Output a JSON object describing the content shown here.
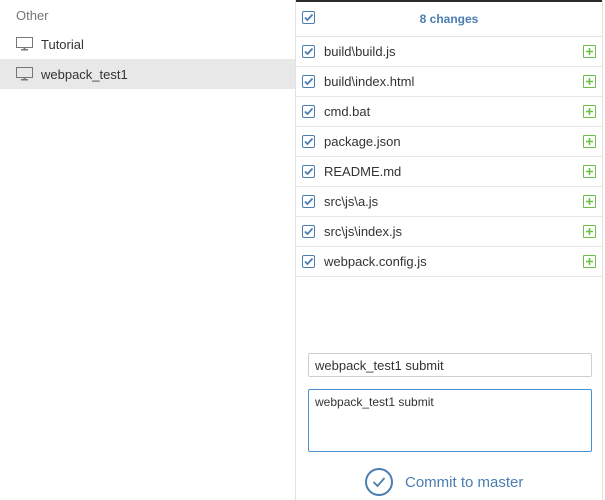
{
  "sidebar": {
    "section_title": "Other",
    "items": [
      {
        "label": "Tutorial",
        "icon": "monitor-icon",
        "selected": false
      },
      {
        "label": "webpack_test1",
        "icon": "monitor-icon",
        "selected": true
      }
    ]
  },
  "changes": {
    "count_label": "8 changes",
    "files": [
      {
        "name": "build\\build.js",
        "status": "added"
      },
      {
        "name": "build\\index.html",
        "status": "added"
      },
      {
        "name": "cmd.bat",
        "status": "added"
      },
      {
        "name": "package.json",
        "status": "added"
      },
      {
        "name": "README.md",
        "status": "added"
      },
      {
        "name": "src\\js\\a.js",
        "status": "added"
      },
      {
        "name": "src\\js\\index.js",
        "status": "added"
      },
      {
        "name": "webpack.config.js",
        "status": "added"
      }
    ]
  },
  "commit": {
    "summary_value": "webpack_test1 submit",
    "description_value": "webpack_test1 submit",
    "button_label": "Commit to master"
  },
  "colors": {
    "accent": "#4a7db0",
    "added": "#6dbf4b",
    "selected_row": "#e8e8e8"
  }
}
